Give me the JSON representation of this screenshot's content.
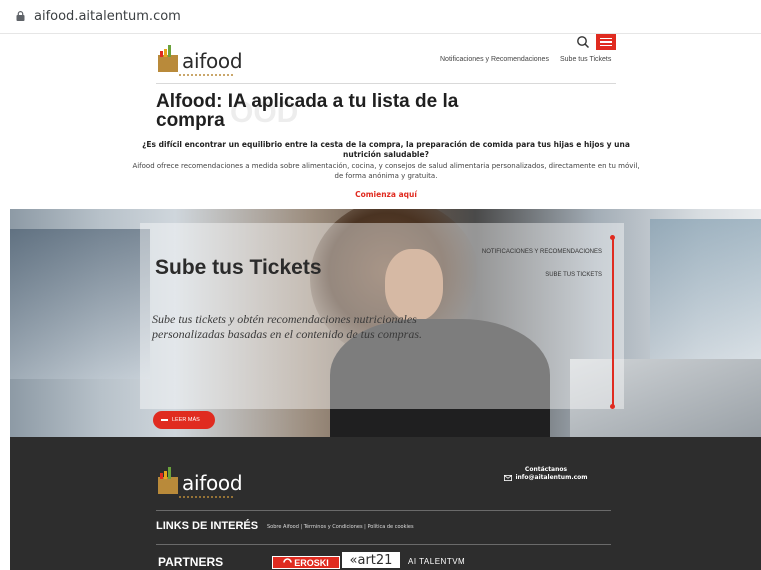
{
  "browser": {
    "url": "aifood.aitalentum.com"
  },
  "header": {
    "logo_text": "aifood",
    "nav": [
      "Notificaciones y Recomendaciones",
      "Sube tus Tickets"
    ]
  },
  "intro": {
    "title": "Alfood: IA aplicada a tu lista de la compra",
    "ghost_text": "OOD",
    "question": "¿Es difícil encontrar un equilibrio entre la cesta de la compra, la preparación de comida para tus hijas e hijos y una nutrición saludable?",
    "description": "Aifood ofrece recomendaciones a medida sobre alimentación, cocina, y consejos de salud alimentaria personalizados, directamente en tu móvil, de forma anónima y gratuita.",
    "cta": "Comienza aquí"
  },
  "banner": {
    "title": "Sube tus Tickets",
    "subtitle": "Sube tus tickets y obtén recomendaciones nutricionales personalizadas basadas en el contenido de tus compras.",
    "button": "LEER MÁS",
    "side_nav": [
      "NOTIFICACIONES Y RECOMENDACIONES",
      "SUBE TUS TICKETS"
    ]
  },
  "footer": {
    "logo_text": "aifood",
    "contact_title": "Contáctanos",
    "contact_email": "info@aitalentum.com",
    "links_title": "LINKS DE INTERÉS",
    "links": [
      "Sobre Aifood",
      "Términos y Condiciones",
      "Política de cookies"
    ],
    "partners_title": "PARTNERS",
    "partners": [
      "EROSKI",
      "«art21",
      "AI TALENTVM"
    ]
  },
  "colors": {
    "accent": "#e02b20",
    "footer_bg": "#2d2d2d"
  }
}
